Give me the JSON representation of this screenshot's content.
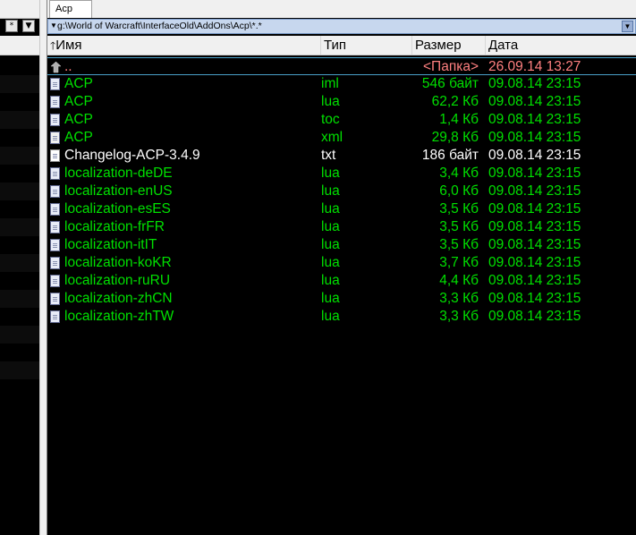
{
  "colors": {
    "accent_row_border": "#4aa0c8",
    "green": "#00e000",
    "white": "#ffffff",
    "folder": "#ff8080",
    "path_bg": "#c7d7ee"
  },
  "left_panel": {
    "buttons": [
      "*",
      "▼"
    ]
  },
  "tab": {
    "label": "Acp"
  },
  "path": {
    "text": "g:\\World of Warcraft\\InterfaceOld\\AddOns\\Acp\\*.*"
  },
  "columns": {
    "name": "Имя",
    "type": "Тип",
    "size": "Размер",
    "date": "Дата"
  },
  "files": [
    {
      "icon": "up-folder-icon",
      "name": "..",
      "type": "",
      "size": "<Папка>",
      "date": "26.09.14 13:27",
      "color": "#ff8080"
    },
    {
      "icon": "file-icon",
      "name": "ACP",
      "type": "iml",
      "size": "546 байт",
      "date": "09.08.14 23:15",
      "color": "#00e000"
    },
    {
      "icon": "file-icon",
      "name": "ACP",
      "type": "lua",
      "size": "62,2 Кб",
      "date": "09.08.14 23:15",
      "color": "#00e000"
    },
    {
      "icon": "file-icon",
      "name": "ACP",
      "type": "toc",
      "size": "1,4 Кб",
      "date": "09.08.14 23:15",
      "color": "#00e000"
    },
    {
      "icon": "xml-file-icon",
      "name": "ACP",
      "type": "xml",
      "size": "29,8 Кб",
      "date": "09.08.14 23:15",
      "color": "#00e000"
    },
    {
      "icon": "text-file-icon",
      "name": "Changelog-ACP-3.4.9",
      "type": "txt",
      "size": "186 байт",
      "date": "09.08.14 23:15",
      "color": "#ffffff"
    },
    {
      "icon": "file-icon",
      "name": "localization-deDE",
      "type": "lua",
      "size": "3,4 Кб",
      "date": "09.08.14 23:15",
      "color": "#00e000"
    },
    {
      "icon": "file-icon",
      "name": "localization-enUS",
      "type": "lua",
      "size": "6,0 Кб",
      "date": "09.08.14 23:15",
      "color": "#00e000"
    },
    {
      "icon": "file-icon",
      "name": "localization-esES",
      "type": "lua",
      "size": "3,5 Кб",
      "date": "09.08.14 23:15",
      "color": "#00e000"
    },
    {
      "icon": "file-icon",
      "name": "localization-frFR",
      "type": "lua",
      "size": "3,5 Кб",
      "date": "09.08.14 23:15",
      "color": "#00e000"
    },
    {
      "icon": "file-icon",
      "name": "localization-itIT",
      "type": "lua",
      "size": "3,5 Кб",
      "date": "09.08.14 23:15",
      "color": "#00e000"
    },
    {
      "icon": "file-icon",
      "name": "localization-koKR",
      "type": "lua",
      "size": "3,7 Кб",
      "date": "09.08.14 23:15",
      "color": "#00e000"
    },
    {
      "icon": "file-icon",
      "name": "localization-ruRU",
      "type": "lua",
      "size": "4,4 Кб",
      "date": "09.08.14 23:15",
      "color": "#00e000"
    },
    {
      "icon": "file-icon",
      "name": "localization-zhCN",
      "type": "lua",
      "size": "3,3 Кб",
      "date": "09.08.14 23:15",
      "color": "#00e000"
    },
    {
      "icon": "file-icon",
      "name": "localization-zhTW",
      "type": "lua",
      "size": "3,3 Кб",
      "date": "09.08.14 23:15",
      "color": "#00e000"
    }
  ]
}
